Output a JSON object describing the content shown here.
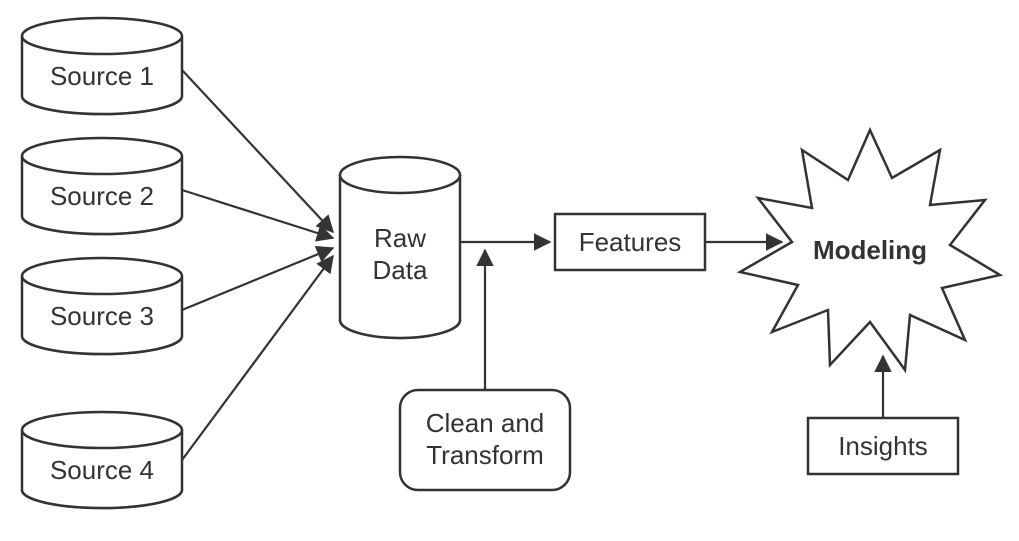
{
  "diagram": {
    "sources": [
      {
        "label": "Source 1"
      },
      {
        "label": "Source 2"
      },
      {
        "label": "Source 3"
      },
      {
        "label": "Source 4"
      }
    ],
    "raw_data": {
      "line1": "Raw",
      "line2": "Data"
    },
    "clean_transform": {
      "line1": "Clean and",
      "line2": "Transform"
    },
    "features": {
      "label": "Features"
    },
    "modeling": {
      "label": "Modeling"
    },
    "insights": {
      "label": "Insights"
    }
  }
}
